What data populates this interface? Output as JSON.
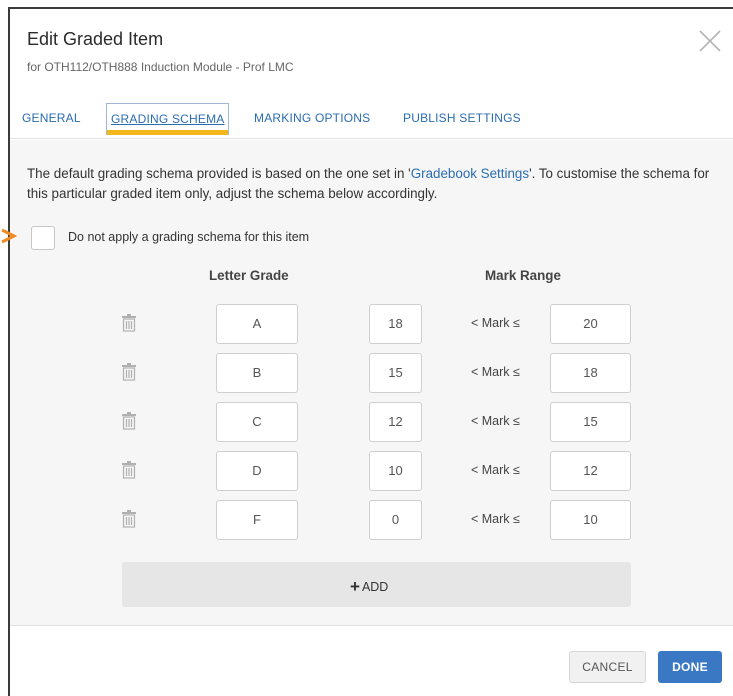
{
  "dialog": {
    "title": "Edit Graded Item",
    "subtitle": "for OTH112/OTH888 Induction Module - Prof LMC"
  },
  "tabs": [
    {
      "label": "GENERAL",
      "active": false
    },
    {
      "label": "GRADING SCHEMA",
      "active": true
    },
    {
      "label": "MARKING OPTIONS",
      "active": false
    },
    {
      "label": "PUBLISH SETTINGS",
      "active": false
    }
  ],
  "intro": {
    "before": "The default grading schema provided is based on the one set in '",
    "link": "Gradebook Settings",
    "after": "'. To customise the schema for this particular graded item only, adjust the schema below accordingly."
  },
  "checkbox": {
    "label": "Do not apply a grading schema for this item",
    "checked": false
  },
  "columns": {
    "letter_grade": "Letter Grade",
    "mark_range": "Mark Range"
  },
  "range_operator": "< Mark ≤",
  "rows": [
    {
      "grade": "A",
      "from": "18",
      "to": "20"
    },
    {
      "grade": "B",
      "from": "15",
      "to": "18"
    },
    {
      "grade": "C",
      "from": "12",
      "to": "15"
    },
    {
      "grade": "D",
      "from": "10",
      "to": "12"
    },
    {
      "grade": "F",
      "from": "0",
      "to": "10"
    }
  ],
  "add_button": {
    "icon": "+",
    "label": "ADD"
  },
  "footer": {
    "cancel_label": "CANCEL",
    "done_label": "DONE"
  },
  "colors": {
    "accent": "#3a78c3",
    "tab_highlight": "#f5b81c",
    "link": "#2a6db0",
    "arrow": "#f08a24"
  }
}
